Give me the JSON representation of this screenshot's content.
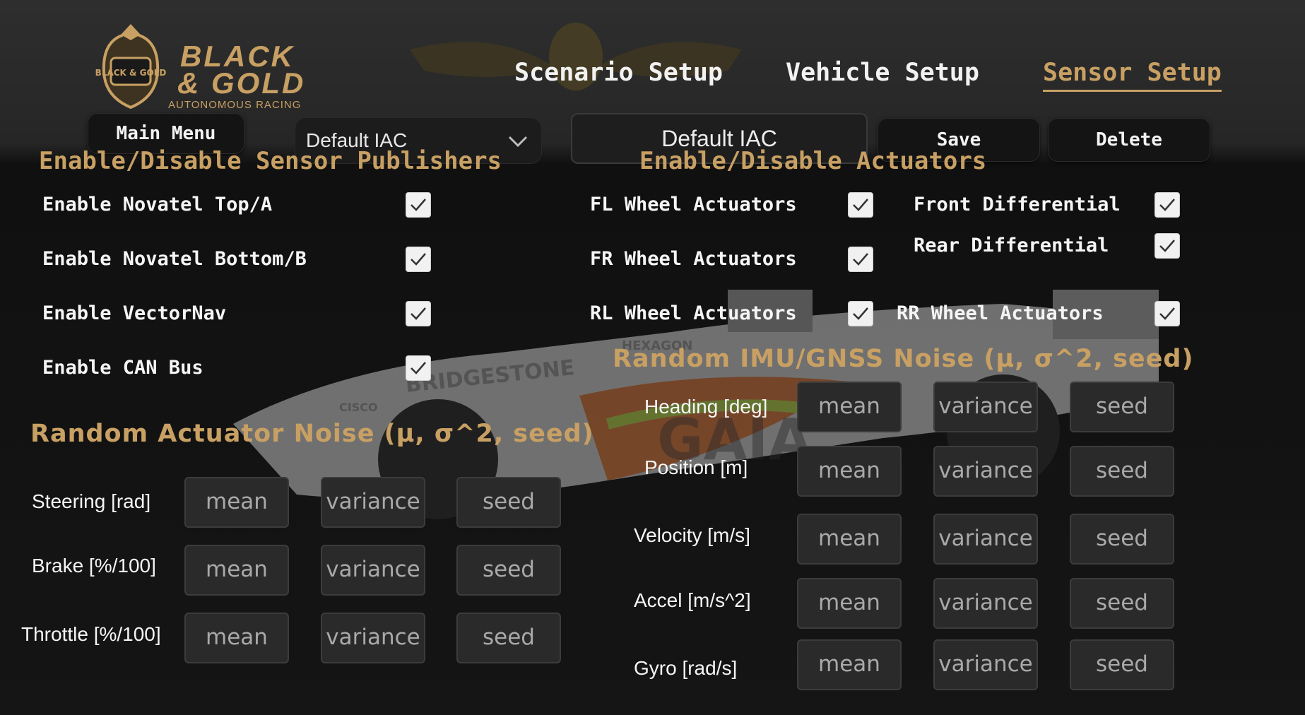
{
  "logo": {
    "line1": "BLACK",
    "line2": "& GOLD",
    "line3": "AUTONOMOUS RACING",
    "badge": "BLACK & GOLD"
  },
  "nav": {
    "tabs": [
      "Scenario Setup",
      "Vehicle Setup",
      "Sensor Setup"
    ],
    "active": "Sensor Setup"
  },
  "toolbar": {
    "main_menu": "Main Menu",
    "profile_select": "Default IAC",
    "profile_name": "Default IAC",
    "save": "Save",
    "delete": "Delete"
  },
  "sensor_publishers": {
    "title": "Enable/Disable Sensor Publishers",
    "items": [
      {
        "label": "Enable Novatel Top/A",
        "checked": true
      },
      {
        "label": "Enable Novatel Bottom/B",
        "checked": true
      },
      {
        "label": "Enable VectorNav",
        "checked": true
      },
      {
        "label": "Enable CAN Bus",
        "checked": true
      }
    ]
  },
  "actuators": {
    "title": "Enable/Disable Actuators",
    "items": [
      {
        "label": "FL Wheel Actuators",
        "checked": true
      },
      {
        "label": "FR Wheel Actuators",
        "checked": true
      },
      {
        "label": "RL Wheel Actuators",
        "checked": true
      },
      {
        "label": "Front Differential",
        "checked": true
      },
      {
        "label": "Rear Differential",
        "checked": true
      },
      {
        "label": "RR Wheel Actuators",
        "checked": true
      }
    ]
  },
  "actuator_noise": {
    "title": "Random Actuator Noise (μ, σ^2, seed)",
    "rows": [
      {
        "label": "Steering [rad]"
      },
      {
        "label": "Brake [%/100]"
      },
      {
        "label": "Throttle [%/100]"
      }
    ]
  },
  "imu_noise": {
    "title": "Random IMU/GNSS Noise (μ, σ^2, seed)",
    "rows": [
      {
        "label": "Heading [deg]"
      },
      {
        "label": "Position [m]"
      },
      {
        "label": "Velocity [m/s]"
      },
      {
        "label": "Accel [m/s^2]"
      },
      {
        "label": "Gyro [rad/s]"
      }
    ]
  },
  "placeholders": {
    "mean": "mean",
    "variance": "variance",
    "seed": "seed"
  },
  "background_text": {
    "sponsor1": "BRIDGESTONE",
    "sponsor2": "GAIA",
    "sponsor3": "HEXAGON",
    "sponsor4": "CISCO"
  },
  "colors": {
    "accent": "#c8a063",
    "background": "#161616",
    "field": "#2a2a2a"
  }
}
